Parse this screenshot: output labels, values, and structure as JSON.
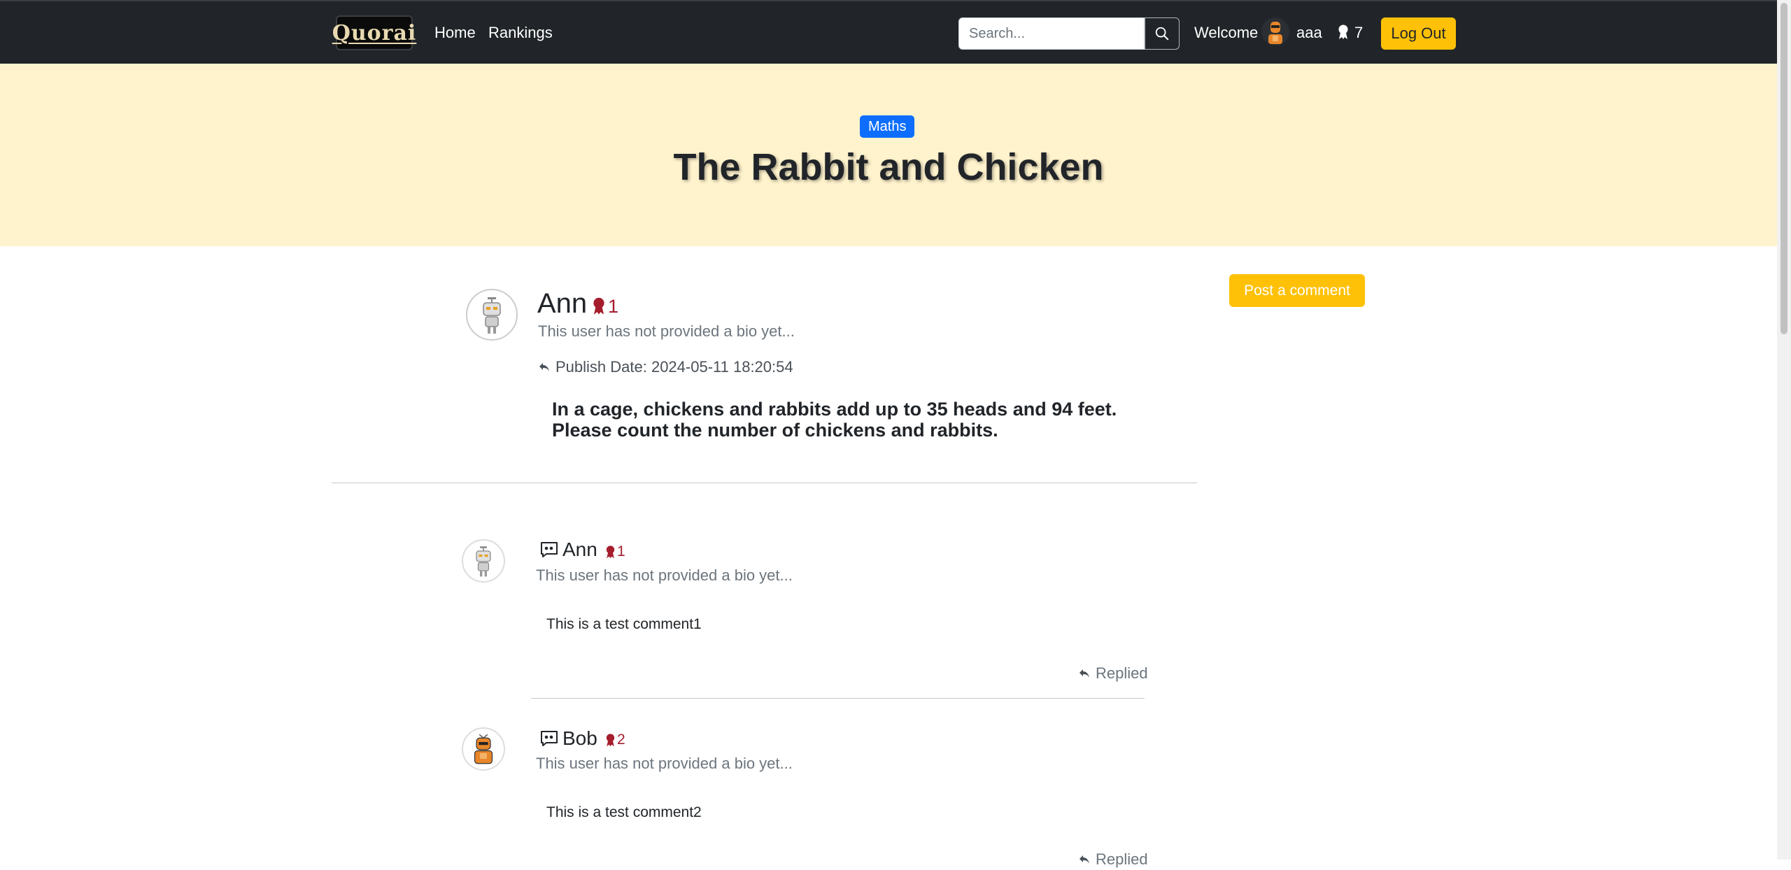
{
  "nav": {
    "logo_text": "Quorai",
    "links": [
      "Home",
      "Rankings"
    ],
    "search_placeholder": "Search...",
    "welcome": "Welcome",
    "username": "aaa",
    "points": "7",
    "logout_label": "Log Out"
  },
  "hero": {
    "tag": "Maths",
    "title": "The Rabbit and Chicken"
  },
  "question": {
    "author": "Ann",
    "rank": "1",
    "bio": "This user has not provided a bio yet...",
    "publish": "Publish Date: 2024-05-11 18:20:54",
    "body_lines": [
      "In a cage, chickens and rabbits add up to 35 heads and 94 feet.",
      "Please count the number of chickens and rabbits."
    ]
  },
  "actions": {
    "post_comment": "Post a comment"
  },
  "comments": [
    {
      "author": "Ann",
      "rank": "1",
      "bio": "This user has not provided a bio yet...",
      "text": "This is a test comment1",
      "status": "Replied"
    },
    {
      "author": "Bob",
      "rank": "2",
      "bio": "This user has not provided a bio yet...",
      "text": "This is a test comment2",
      "status": "Replied"
    }
  ],
  "colors": {
    "navbar": "#212529",
    "hero_bg": "#fff3cd",
    "accent_yellow": "#ffc107",
    "tag_blue": "#0d6efd",
    "rank_red": "#a51d2d"
  }
}
